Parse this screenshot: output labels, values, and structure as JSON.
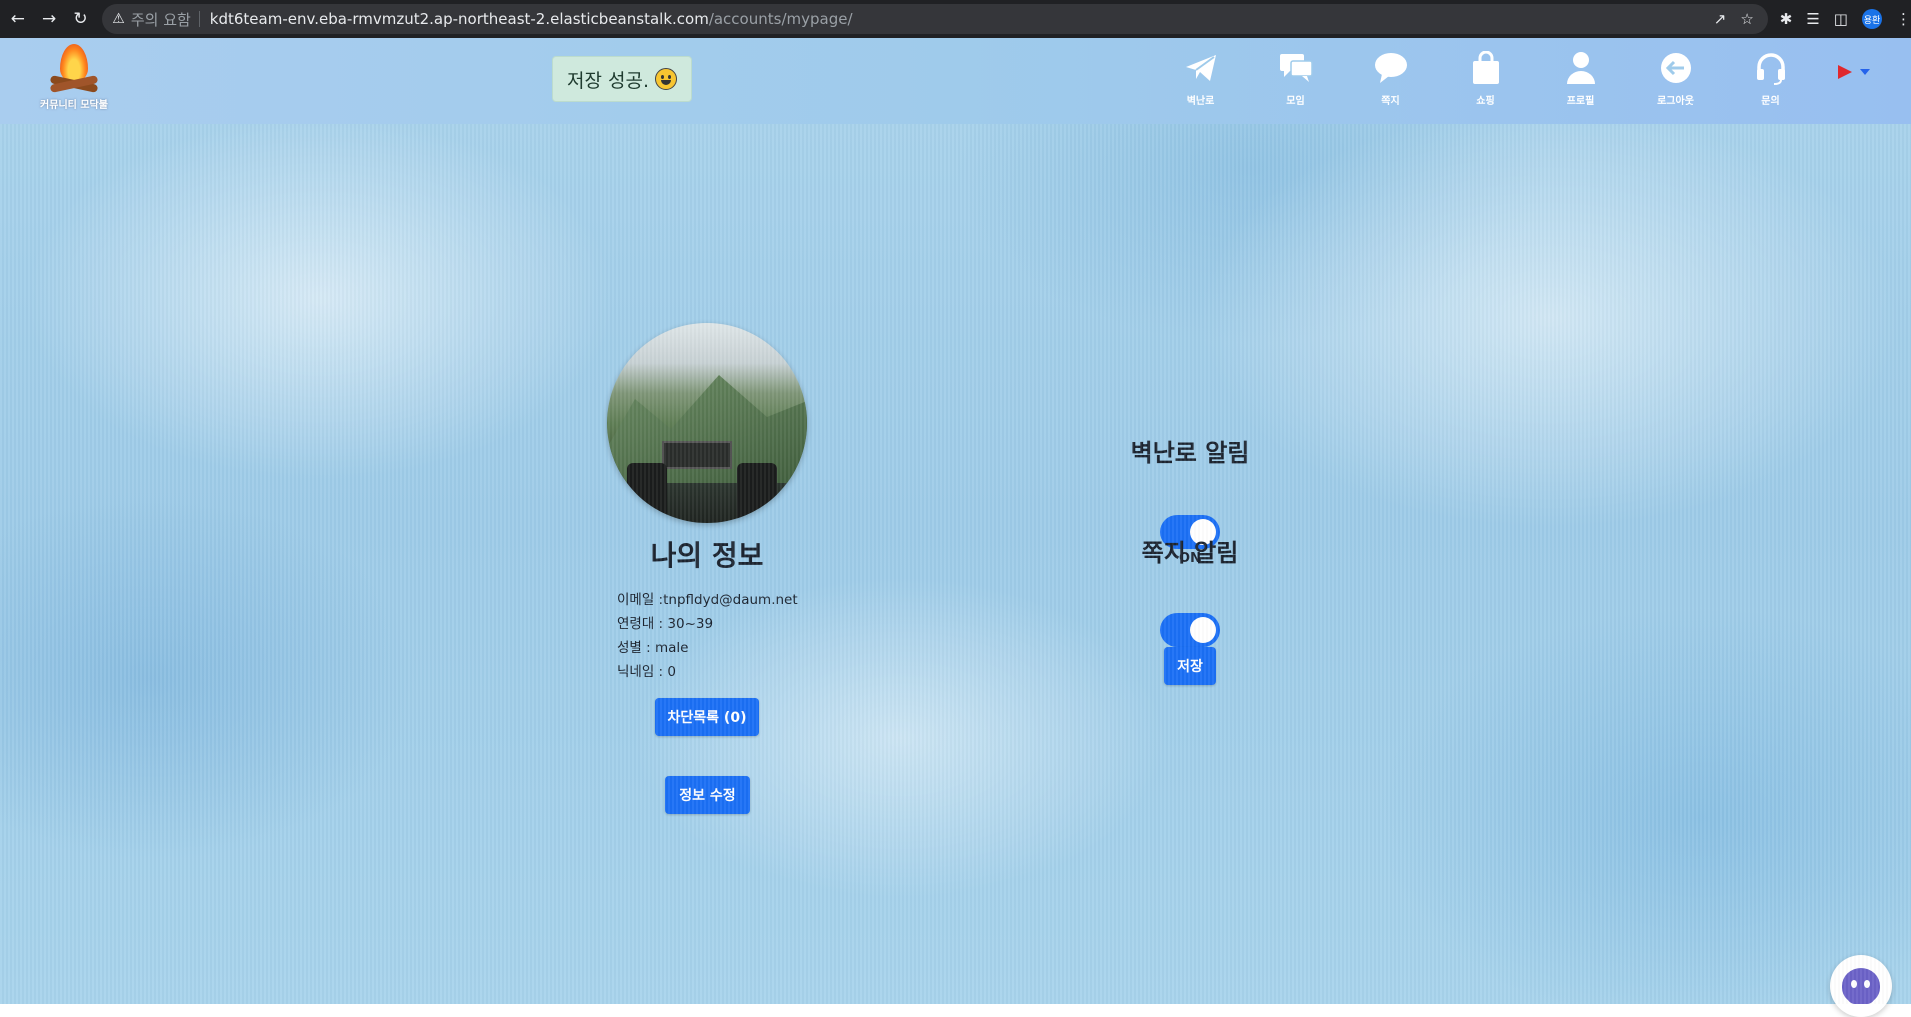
{
  "browser": {
    "security_warning": "주의 요함",
    "url_host": "kdt6team-env.eba-rmvmzut2.ap-northeast-2.elasticbeanstalk.com",
    "url_path": "/accounts/mypage/",
    "profile_initials": "용환"
  },
  "header": {
    "logo_text": "커뮤니티 모닥불",
    "toast_message": "저장 성공.",
    "menu": [
      {
        "label": "벽난로",
        "icon": "paper-plane-icon"
      },
      {
        "label": "모임",
        "icon": "chat-bubbles-icon"
      },
      {
        "label": "쪽지",
        "icon": "speech-bubble-icon"
      },
      {
        "label": "쇼핑",
        "icon": "shopping-bag-icon"
      },
      {
        "label": "프로필",
        "icon": "person-icon"
      },
      {
        "label": "로그아웃",
        "icon": "logout-arrow-icon"
      },
      {
        "label": "문의",
        "icon": "headset-icon"
      }
    ]
  },
  "profile": {
    "title": "나의 정보",
    "email": "이메일 :tnpfldyd@daum.net",
    "age_range": "연령대 : 30~39",
    "gender": "성별 : male",
    "nickname": "닉네임 : 0",
    "block_list_button": "차단목록 (0)",
    "edit_button": "정보 수정"
  },
  "alarms": {
    "fireplace_title": "벽난로 알림",
    "fireplace_state": "ON",
    "message_title": "쪽지 알림",
    "message_state": "ON",
    "save_button": "저장"
  },
  "colors": {
    "primary_button": "#1a6ff5",
    "toast_background": "#cfe9dd",
    "header_background": "#a9cdef"
  }
}
